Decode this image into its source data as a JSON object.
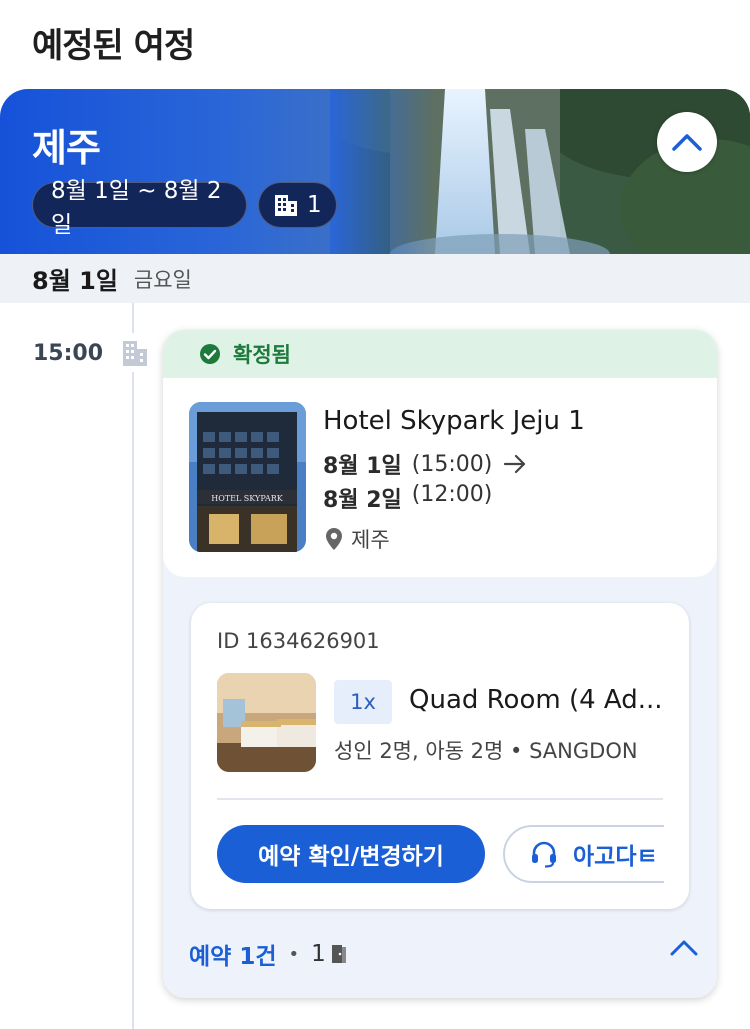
{
  "page_title": "예정된 여정",
  "hero": {
    "city": "제주",
    "date_range": "8월 1일 ~ 8월 2일",
    "hotel_count": "1"
  },
  "date_header": {
    "date": "8월 1일",
    "weekday": "금요일"
  },
  "timeline": {
    "time": "15:00"
  },
  "booking": {
    "status": "확정됨",
    "hotel": {
      "name": "Hotel Skypark Jeju 1",
      "checkin_date": "8월 1일",
      "checkin_time": "(15:00)",
      "checkout_date": "8월 2일",
      "checkout_time": "(12:00)",
      "location": "제주",
      "image_sign_text": "HOTEL SKYPARK"
    },
    "room": {
      "booking_id": "ID 1634626901",
      "quantity": "1x",
      "name": "Quad Room (4 Ad...",
      "guests": "성인 2명, 아동 2명 • SANGDON"
    },
    "actions": {
      "primary": "예약 확인/변경하기",
      "secondary": "아고다ㅌ"
    },
    "footer": {
      "count": "예약 1건",
      "separator": "•",
      "rooms": "1"
    }
  },
  "colors": {
    "accent": "#1b5fd6",
    "confirmed": "#1e7a3c",
    "confirmed_bg": "#dff2e6",
    "hero_blue": "#1552d9"
  },
  "icons": {
    "collapse": "chevron-up-icon",
    "building": "building-icon",
    "check": "check-circle-icon",
    "arrow": "arrow-right-icon",
    "location": "location-pin-icon",
    "support": "headset-icon",
    "door": "door-icon"
  }
}
